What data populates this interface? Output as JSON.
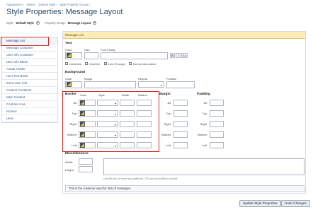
{
  "breadcrumb": [
    "Appearance ›",
    "Styles ›",
    "Default Style ›",
    "Style Property Groups ›"
  ],
  "page_title": "Style Properties: Message Layout",
  "style_label": "Style:",
  "style_value": "Default Style",
  "group_label": "Property Group:",
  "group_value": "Message Layout",
  "sidebar": {
    "items": [
      {
        "label": "Message List"
      },
      {
        "label": "Message Container"
      },
      {
        "label": "User Info Container"
      },
      {
        "label": "User Info Block"
      },
      {
        "label": "Avatar Holder"
      },
      {
        "label": "User Text Block"
      },
      {
        "label": "Extra User Info"
      },
      {
        "label": "Content Container"
      },
      {
        "label": "Main Content"
      },
      {
        "label": "Controls Area"
      },
      {
        "label": "Notices"
      },
      {
        "label": "Likes"
      }
    ]
  },
  "panel": {
    "header": "Message List",
    "text_section": {
      "title": "Text",
      "color_label": "Color",
      "size_label": "Size",
      "font_family_label": "Font Family",
      "bold_btn": "B",
      "italic_btn": "I",
      "size_btn": "Aa",
      "underline": "Underline",
      "overline": "Overline",
      "line_through": "Line-Through",
      "no_decoration": "No text decoration"
    },
    "background_section": {
      "title": "Background",
      "color_label": "Color",
      "image_label": "Image",
      "repeat_label": "Repeat",
      "position_label": "Position"
    },
    "border_section": {
      "title": "Border",
      "color_label": "Color",
      "style_label": "Style",
      "width_label": "Width",
      "radius_label": "Radius",
      "rows": [
        "All:",
        "Top:",
        "Right:",
        "Bottom:",
        "Left:"
      ]
    },
    "margin_section": {
      "title": "Margin",
      "rows": [
        "All:",
        "Top:",
        "Right:",
        "Bottom:",
        "Left:"
      ]
    },
    "padding_section": {
      "title": "Padding",
      "rows": [
        "All:",
        "Top:",
        "Right:",
        "Bottom:",
        "Left:"
      ]
    },
    "misc_section": {
      "title": "Miscellaneous",
      "width_label": "Width:",
      "height_label": "Height:",
      "css_note": "Use this box to enter any additional CSS you would like to include."
    },
    "description": "This is the container used for lists of messages."
  },
  "buttons": {
    "update": "Update Style Properties",
    "undo": "Undo Changes"
  }
}
